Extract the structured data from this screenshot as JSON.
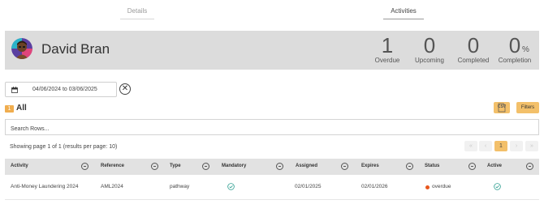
{
  "tabs": {
    "details": "Details",
    "activities": "Activities",
    "active": "activities"
  },
  "profile": {
    "name": "David Bran",
    "stats": {
      "overdue": {
        "value": "1",
        "label": "Overdue"
      },
      "upcoming": {
        "value": "0",
        "label": "Upcoming"
      },
      "completed": {
        "value": "0",
        "label": "Completed"
      },
      "completion": {
        "value": "0",
        "label": "Completion",
        "unit": "%"
      }
    }
  },
  "filters": {
    "date_range": "04/06/2024 to 03/06/2025",
    "group_count": "1",
    "group_label": "All",
    "csv_label": "CSV",
    "filters_label": "Filters",
    "search_placeholder": "Search Rows..."
  },
  "pagination": {
    "summary": "Showing page 1 of 1 (results per page: 10)",
    "first": "«",
    "prev": "‹",
    "current": "1",
    "next": "›",
    "last": "»"
  },
  "table": {
    "columns": {
      "activity": "Activity",
      "reference": "Reference",
      "type": "Type",
      "mandatory": "Mandatory",
      "assigned": "Assigned",
      "expires": "Expires",
      "status": "Status",
      "active": "Active"
    },
    "rows": [
      {
        "activity": "Anti-Money Laundering 2024",
        "reference": "AML2024",
        "type": "pathway",
        "mandatory": true,
        "assigned": "02/01/2025",
        "expires": "02/01/2026",
        "status": "overdue",
        "active": true
      }
    ]
  },
  "colors": {
    "accent": "#f3c06a",
    "badge": "#f0ad4e",
    "status_overdue": "#e8571d",
    "check": "#2a9d8f"
  }
}
